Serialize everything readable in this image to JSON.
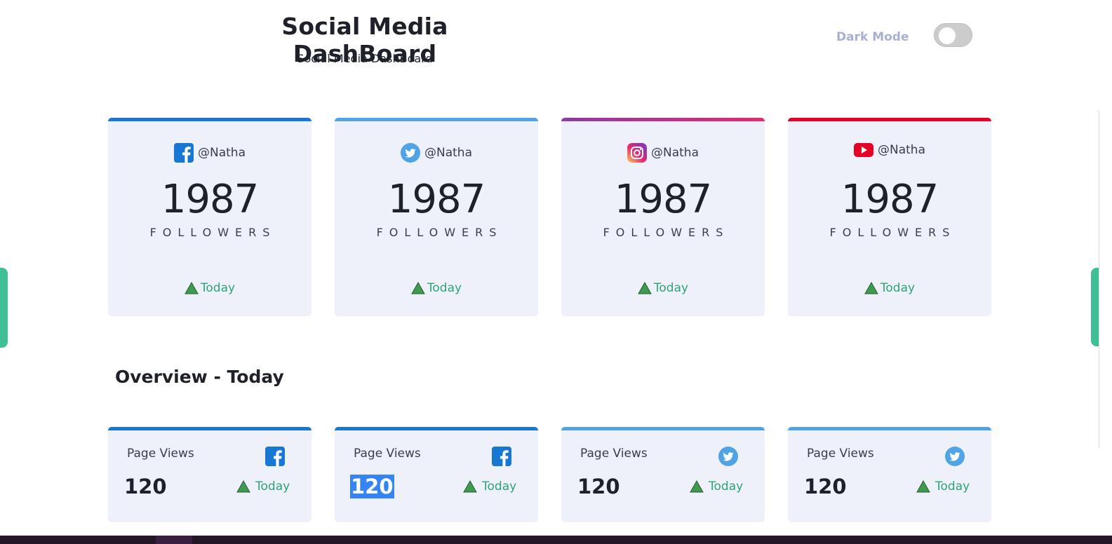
{
  "header": {
    "title": "Social Media DashBoard",
    "subtitle": "Social Media DashBoard",
    "dark_mode_label": "Dark Mode",
    "dark_mode_on": false
  },
  "colors": {
    "facebook": "#1877d3",
    "twitter": "#4fa3e6",
    "instagram_start": "#e5296e",
    "instagram_end": "#8e3aa7",
    "youtube": "#e60026",
    "up_green": "#2ea376",
    "card_bg": "#eef1fa"
  },
  "followers": [
    {
      "platform": "facebook",
      "icon": "facebook-icon",
      "handle": "@Natha",
      "count": "1987",
      "label": "FOLLOWERS",
      "trend": "Today"
    },
    {
      "platform": "twitter",
      "icon": "twitter-icon",
      "handle": "@Natha",
      "count": "1987",
      "label": "FOLLOWERS",
      "trend": "Today"
    },
    {
      "platform": "instagram",
      "icon": "instagram-icon",
      "handle": "@Natha",
      "count": "1987",
      "label": "FOLLOWERS",
      "trend": "Today"
    },
    {
      "platform": "youtube",
      "icon": "youtube-icon",
      "handle": "@Natha",
      "count": "1987",
      "label": "FOLLOWERS",
      "trend": "Today"
    }
  ],
  "overview": {
    "title": "Overview - Today",
    "cards": [
      {
        "platform": "facebook",
        "icon": "facebook-icon",
        "metric": "Page Views",
        "value": "120",
        "trend": "Today"
      },
      {
        "platform": "facebook",
        "icon": "facebook-icon",
        "metric": "Page Views",
        "value": "120",
        "trend": "Today"
      },
      {
        "platform": "twitter",
        "icon": "twitter-icon",
        "metric": "Page Views",
        "value": "120",
        "trend": "Today"
      },
      {
        "platform": "twitter",
        "icon": "twitter-icon",
        "metric": "Page Views",
        "value": "120",
        "trend": "Today"
      }
    ]
  }
}
